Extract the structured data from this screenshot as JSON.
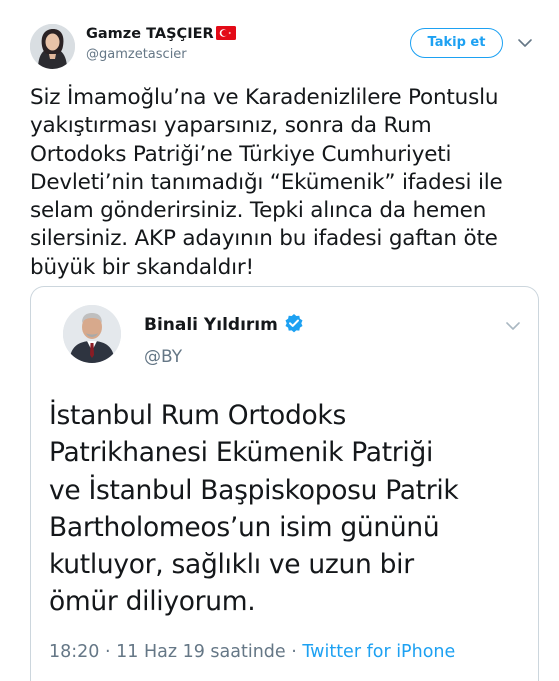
{
  "author": {
    "display_name": "Gamze TAŞÇIER",
    "handle": "@gamzetascier",
    "flag_icon": "turkey-flag-icon"
  },
  "follow_button": {
    "label": "Takip et"
  },
  "tweet": {
    "lines": [
      "Siz İmamoğlu’na ve Karadenizlilere Pontuslu",
      "yakıştırması yaparsınız, sonra da Rum",
      "Ortodoks Patriği’ne Türkiye Cumhuriyeti",
      "Devleti’nin tanımadığı “Ekümenik” ifadesi ile",
      "selam gönderirsiniz. Tepki alınca da hemen",
      "silersiniz. AKP adayının bu ifadesi gaftan öte",
      "büyük bir skandaldır!"
    ]
  },
  "quoted": {
    "display_name": "Binali Yıldırım",
    "handle": "@BY",
    "verified_icon": "verified-badge-icon",
    "lines": [
      "İstanbul Rum Ortodoks",
      "Patrikhanesi Ekümenik Patriği",
      "ve İstanbul Başpiskoposu Patrik",
      "Bartholomeos’un isim gününü",
      "kutluyor, sağlıklı ve uzun bir",
      "ömür diliyorum."
    ],
    "meta_time": "18:20 · 11 Haz 19 saatinde · ",
    "meta_source": "Twitter for iPhone"
  },
  "colors": {
    "accent": "#1da1f2",
    "text": "#14171a",
    "secondary": "#657786",
    "border": "#ccd6dd",
    "flag_red": "#e30a17"
  }
}
